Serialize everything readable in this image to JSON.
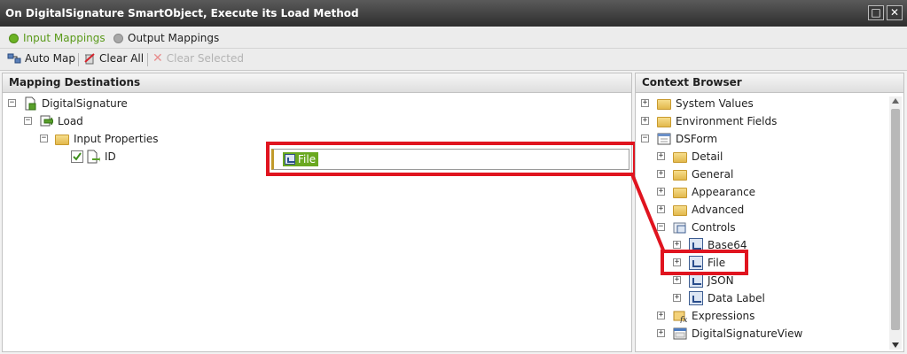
{
  "window": {
    "title": "On DigitalSignature SmartObject, Execute its Load Method",
    "restore_glyph": "□",
    "close_glyph": "✕"
  },
  "tabs": [
    {
      "label": "Input Mappings",
      "active": true,
      "color": "#6bb224"
    },
    {
      "label": "Output Mappings",
      "active": false,
      "color": "#9a9a9a"
    }
  ],
  "toolbar": {
    "auto_map": "Auto Map",
    "clear_all": "Clear All",
    "clear_selected": "Clear Selected"
  },
  "mapping_destinations": {
    "header": "Mapping Destinations",
    "tree": {
      "root": "DigitalSignature",
      "method": "Load",
      "group": "Input Properties",
      "field": "ID"
    },
    "mapped_value": "File"
  },
  "context_browser": {
    "header": "Context Browser",
    "items": {
      "system_values": "System Values",
      "environment_fields": "Environment Fields",
      "dsform": "DSForm",
      "detail": "Detail",
      "general": "General",
      "appearance": "Appearance",
      "advanced": "Advanced",
      "controls": "Controls",
      "base64": "Base64",
      "file": "File",
      "json": "JSON",
      "data_label": "Data Label",
      "expressions": "Expressions",
      "view": "DigitalSignatureView"
    }
  },
  "colors": {
    "highlight": "#e0141f",
    "chip": "#6aa820"
  }
}
